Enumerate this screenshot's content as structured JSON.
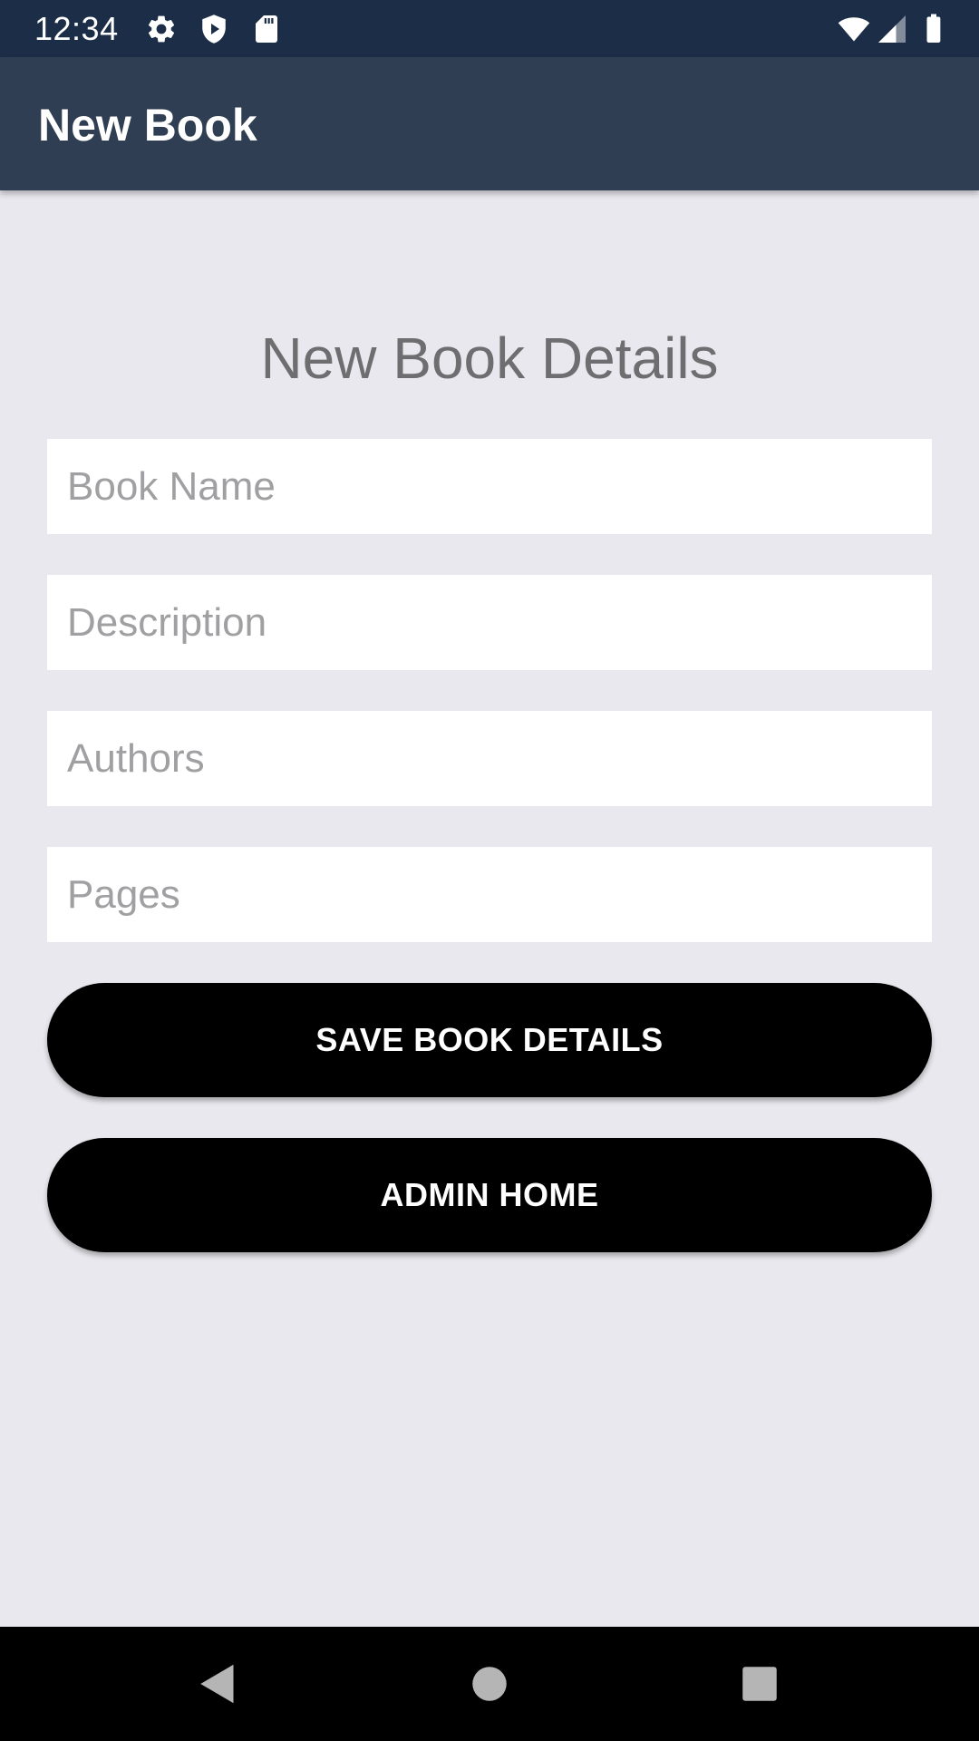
{
  "status_bar": {
    "time": "12:34",
    "icons_left": [
      "settings-icon",
      "shield-icon",
      "sd-card-icon"
    ],
    "icons_right": [
      "wifi-icon",
      "cell-signal-icon",
      "battery-icon"
    ]
  },
  "app_bar": {
    "title": "New Book"
  },
  "form": {
    "heading": "New Book Details",
    "book_name": {
      "placeholder": "Book Name",
      "value": ""
    },
    "description": {
      "placeholder": "Description",
      "value": ""
    },
    "authors": {
      "placeholder": "Authors",
      "value": ""
    },
    "pages": {
      "placeholder": "Pages",
      "value": ""
    },
    "save_label": "SAVE BOOK DETAILS",
    "admin_home_label": "ADMIN HOME"
  },
  "nav_bar": {
    "buttons": [
      "back-icon",
      "home-icon",
      "recents-icon"
    ]
  },
  "colors": {
    "status_bar": "#1C2E47",
    "app_bar": "#2F3E52",
    "background": "#E8E8EE",
    "button": "#000000",
    "heading_text": "#6E6E70",
    "placeholder_text": "#A0A0A3"
  }
}
